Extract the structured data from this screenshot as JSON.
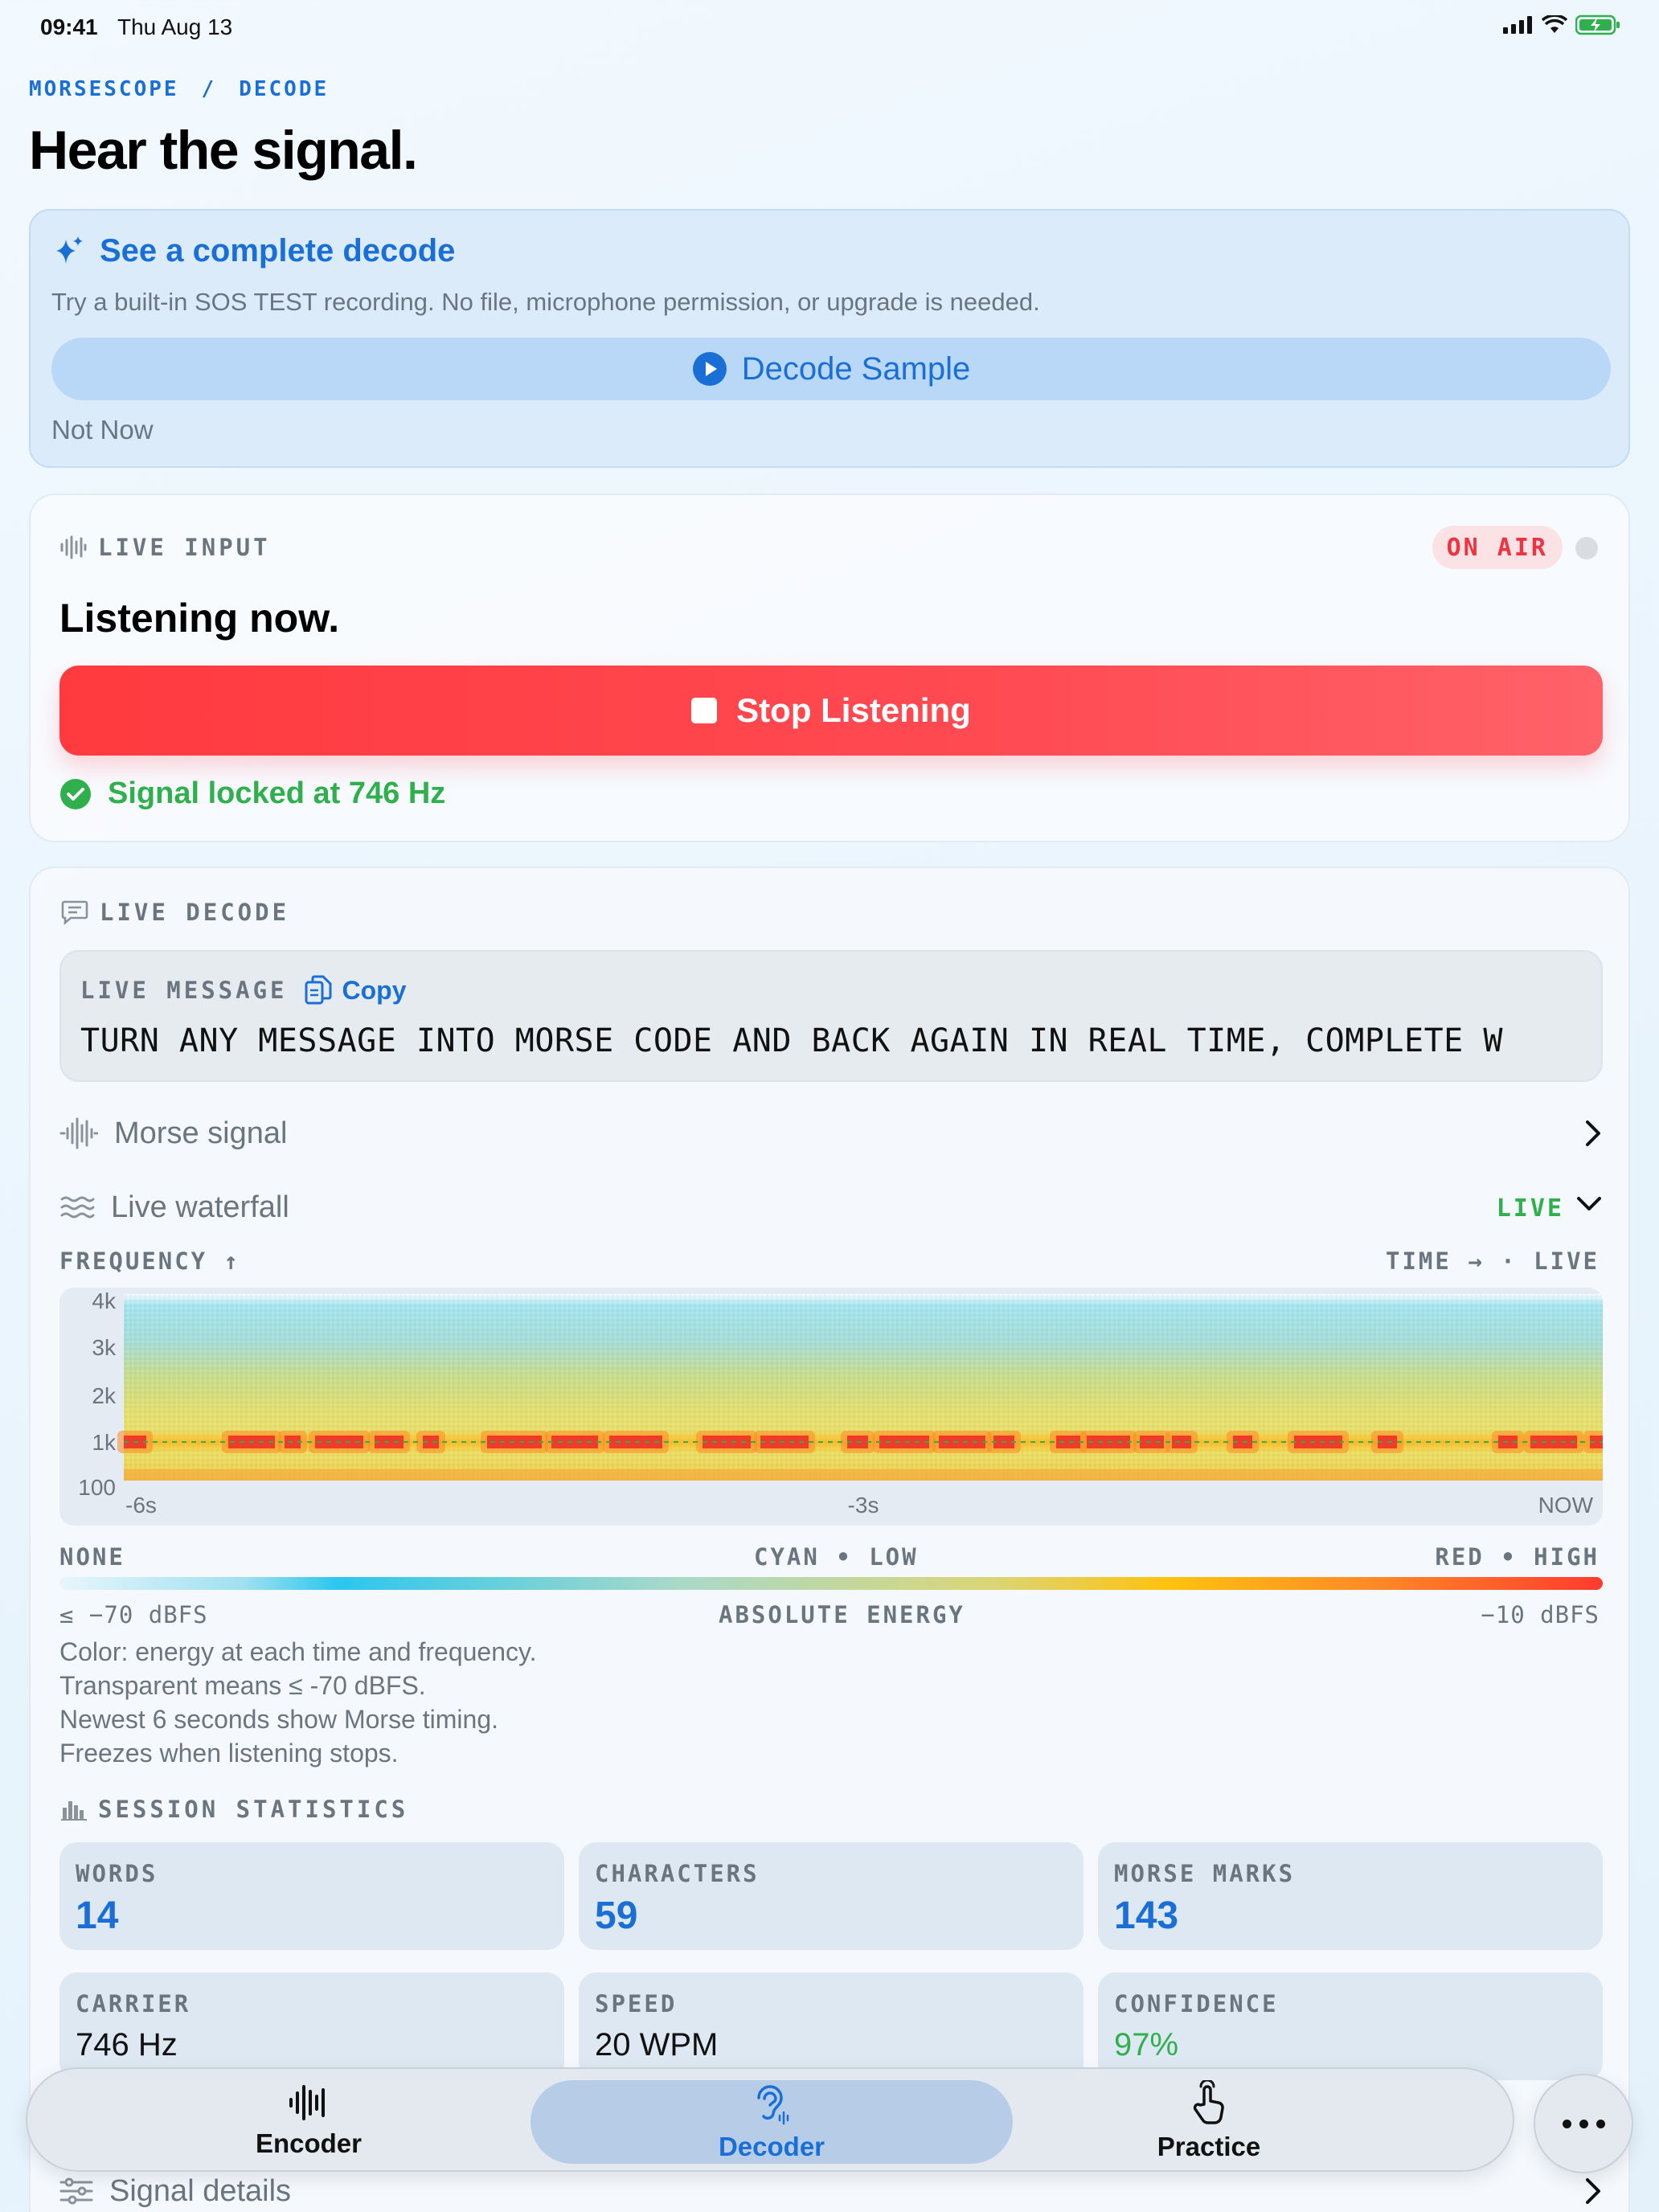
{
  "status": {
    "time": "09:41",
    "date": "Thu Aug 13"
  },
  "breadcrumb": {
    "app": "MORSESCOPE",
    "separator": "/",
    "section": "DECODE"
  },
  "header": {
    "title": "Hear the signal."
  },
  "promo": {
    "title": "See a complete decode",
    "description": "Try a built-in SOS TEST recording. No file, microphone permission, or upgrade is needed.",
    "decode_button": "Decode Sample",
    "dismiss": "Not Now"
  },
  "live_input": {
    "label": "LIVE INPUT",
    "badge": "ON AIR",
    "heading": "Listening now.",
    "stop_button": "Stop Listening",
    "signal_status": "Signal locked at 746 Hz"
  },
  "live_decode": {
    "label": "LIVE DECODE",
    "message_label": "LIVE MESSAGE",
    "copy_label": "Copy",
    "message": "TURN ANY MESSAGE INTO MORSE CODE AND BACK AGAIN IN REAL TIME, COMPLETE W",
    "morse_signal_label": "Morse signal",
    "waterfall_label": "Live waterfall",
    "waterfall_tag": "LIVE",
    "frequency_caption": "FREQUENCY ↑",
    "time_caption": "TIME → · LIVE"
  },
  "spectrogram": {
    "y_ticks": [
      "4k",
      "3k",
      "2k",
      "1k",
      "100"
    ],
    "x_ticks": [
      "-6s",
      "-3s",
      "NOW"
    ],
    "carrier_hz": 746,
    "y_range_hz": [
      100,
      4000
    ],
    "x_range_s": [
      -6,
      0
    ]
  },
  "energy_scale": {
    "none_label": "NONE",
    "low_label": "CYAN • LOW",
    "high_label": "RED • HIGH",
    "min_label": "≤ −70 dBFS",
    "title": "ABSOLUTE ENERGY",
    "max_label": "−10 dBFS",
    "gradient": [
      "#e8f6fb",
      "#2cc6ee",
      "#d9d67a",
      "#ffc20e",
      "#ff3b2e"
    ]
  },
  "legend_notes": [
    "Color: energy at each time and frequency.",
    "Transparent means ≤ -70 dBFS.",
    "Newest 6 seconds show Morse timing.",
    "Freezes when listening stops."
  ],
  "stats": {
    "label": "SESSION STATISTICS",
    "items": [
      {
        "name": "WORDS",
        "value": "14"
      },
      {
        "name": "CHARACTERS",
        "value": "59"
      },
      {
        "name": "MORSE MARKS",
        "value": "143"
      },
      {
        "name": "CARRIER",
        "value": "746 Hz"
      },
      {
        "name": "SPEED",
        "value": "20 WPM"
      },
      {
        "name": "CONFIDENCE",
        "value": "97%"
      }
    ]
  },
  "signal_details_label": "Signal details",
  "tabs": [
    {
      "label": "Encoder",
      "icon": "waveform-icon"
    },
    {
      "label": "Decoder",
      "icon": "ear-icon"
    },
    {
      "label": "Practice",
      "icon": "tap-hand-icon"
    }
  ],
  "colors": {
    "accent": "#1a6fd6",
    "danger": "#ff3a3f",
    "success": "#2fb04d",
    "muted": "#6b7580"
  }
}
